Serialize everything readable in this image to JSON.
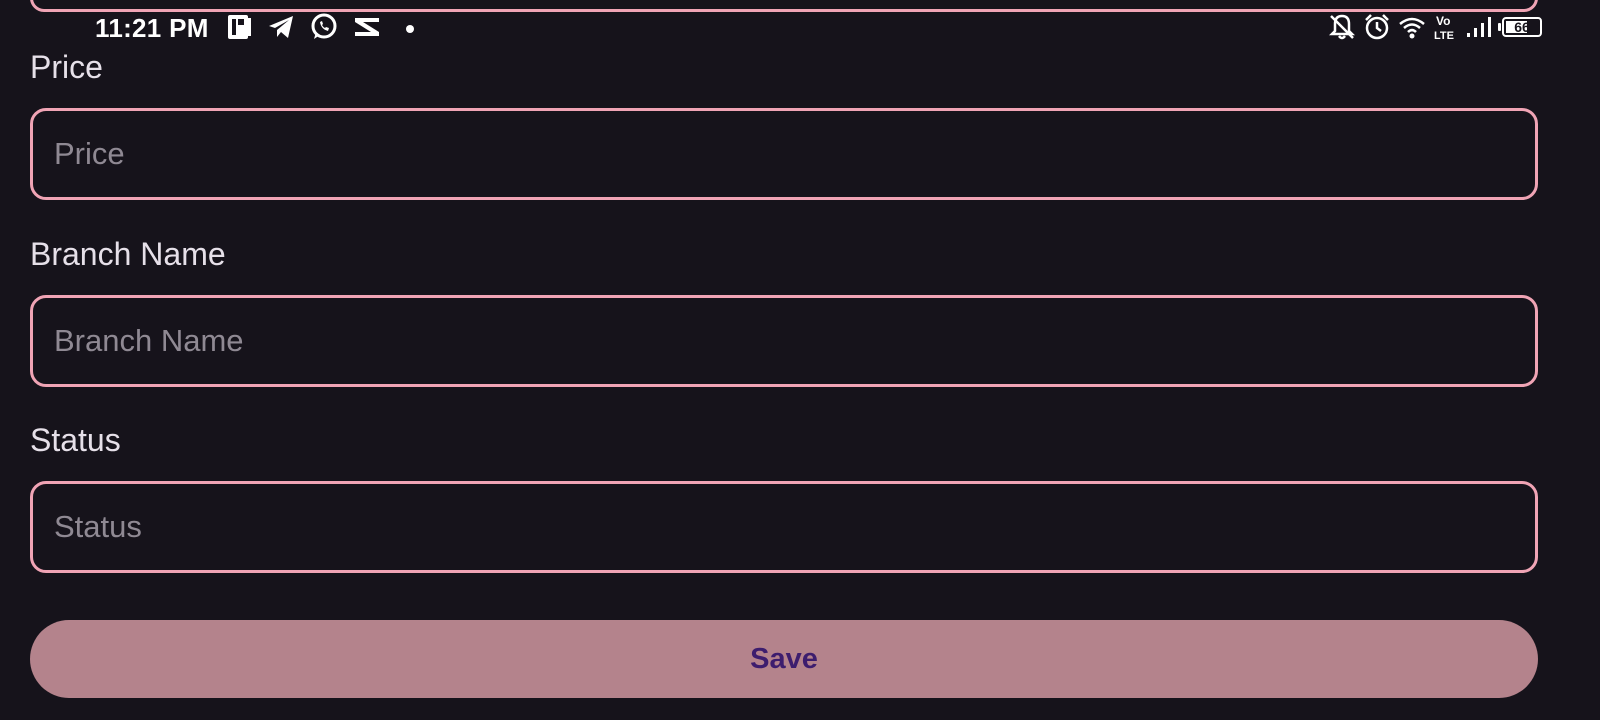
{
  "status_bar": {
    "time": "11:21 PM",
    "left_icons": [
      "document-app-icon",
      "telegram-icon",
      "whatsapp-icon",
      "capcut-icon",
      "notification-dot"
    ],
    "right_icons": [
      "notifications-off-icon",
      "alarm-icon",
      "wifi-icon",
      "volte-icon",
      "signal-icon",
      "battery-icon"
    ],
    "volte_label": "Vo LTE",
    "battery_level": "66",
    "battery_fraction": 0.66
  },
  "form": {
    "price": {
      "label": "Price",
      "placeholder": "Price",
      "value": ""
    },
    "branch_name": {
      "label": "Branch Name",
      "placeholder": "Branch Name",
      "value": ""
    },
    "status": {
      "label": "Status",
      "placeholder": "Status",
      "value": ""
    },
    "save_label": "Save"
  },
  "colors": {
    "background": "#16131b",
    "field_border": "#f0a4b5",
    "button_bg": "#b4838c",
    "button_text": "#3d1d6e",
    "label_text": "#e6e0e9",
    "placeholder_text": "#8f8993"
  }
}
